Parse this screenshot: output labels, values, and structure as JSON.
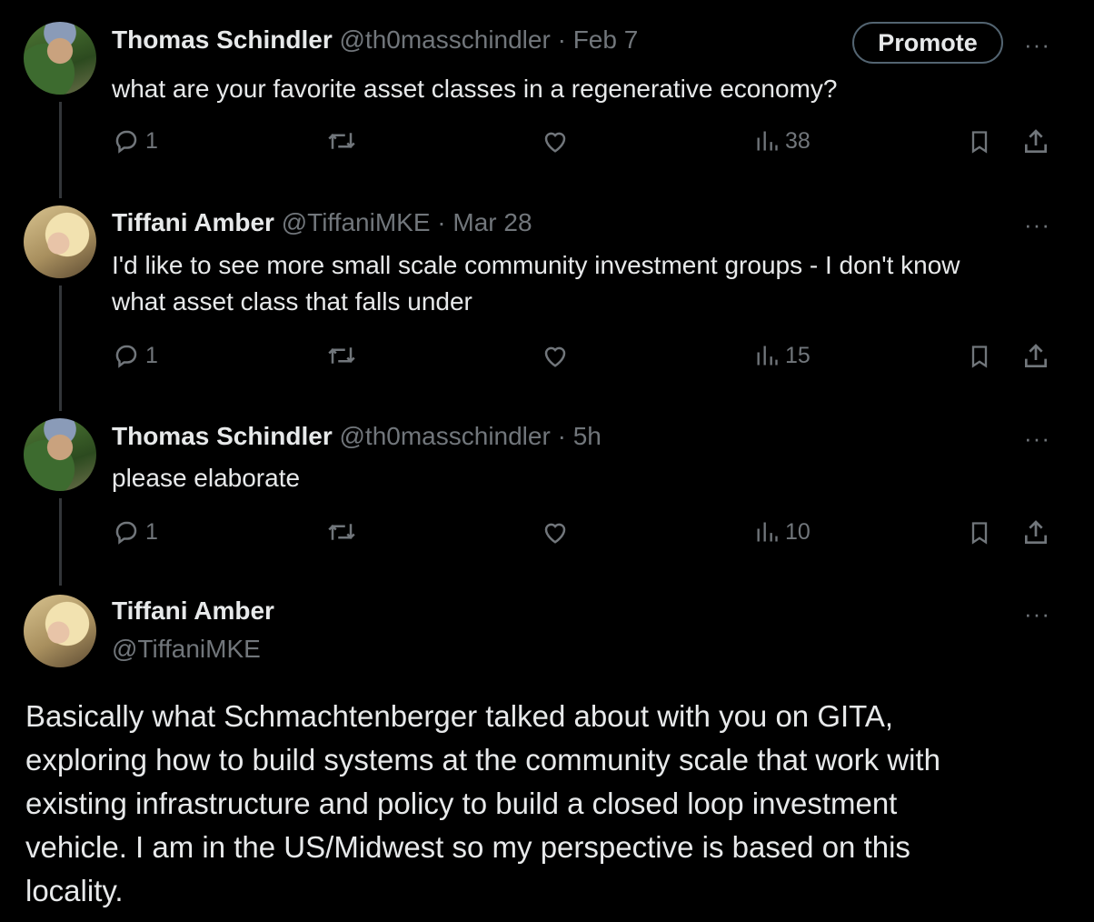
{
  "tweets": [
    {
      "name": "Thomas Schindler",
      "handle": "@th0masschindler",
      "date": "Feb 7",
      "text": "what are your favorite asset classes in a regenerative economy?",
      "replies": "1",
      "views": "38",
      "more": "···",
      "promote": "Promote"
    },
    {
      "name": "Tiffani Amber",
      "handle": "@TiffaniMKE",
      "date": "Mar 28",
      "text_line1": "I'd like to see more small scale community investment groups - I don't know",
      "text_line2": "what asset class that falls under",
      "replies": "1",
      "views": "15",
      "more": "···"
    },
    {
      "name": "Thomas Schindler",
      "handle": "@th0masschindler",
      "date": "5h",
      "text": "please elaborate",
      "replies": "1",
      "views": "10",
      "more": "···"
    },
    {
      "name": "Tiffani Amber",
      "handle": "@TiffaniMKE",
      "more": "···",
      "text_lines": [
        "Basically what Schmachtenberger talked about with you on GITA,",
        "exploring how to build systems at the community scale that work with",
        "existing infrastructure and policy to build a closed loop investment",
        "vehicle. I am in the US/Midwest so my perspective is based on this",
        "locality."
      ]
    }
  ],
  "separator": " · ",
  "colors": {
    "background": "#000000",
    "text": "#e7e9ea",
    "muted": "#71767b",
    "thread": "#333639"
  },
  "icons": [
    "reply-icon",
    "retweet-icon",
    "like-icon",
    "views-icon",
    "bookmark-icon",
    "share-icon",
    "more-icon"
  ]
}
